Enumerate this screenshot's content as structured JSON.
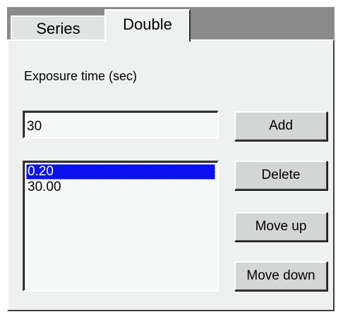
{
  "tabs": {
    "series_label": "Series",
    "double_label": "Double",
    "active": "Double"
  },
  "exposure": {
    "label": "Exposure time (sec)",
    "value": "30"
  },
  "list": {
    "items": [
      "0.20",
      "30.00"
    ],
    "selected_index": 0
  },
  "buttons": {
    "add": "Add",
    "delete": "Delete",
    "move_up": "Move up",
    "move_down": "Move down"
  },
  "colors": {
    "selection": "#0b10ee",
    "panel": "#eef1f0",
    "button": "#d4d6d5"
  }
}
